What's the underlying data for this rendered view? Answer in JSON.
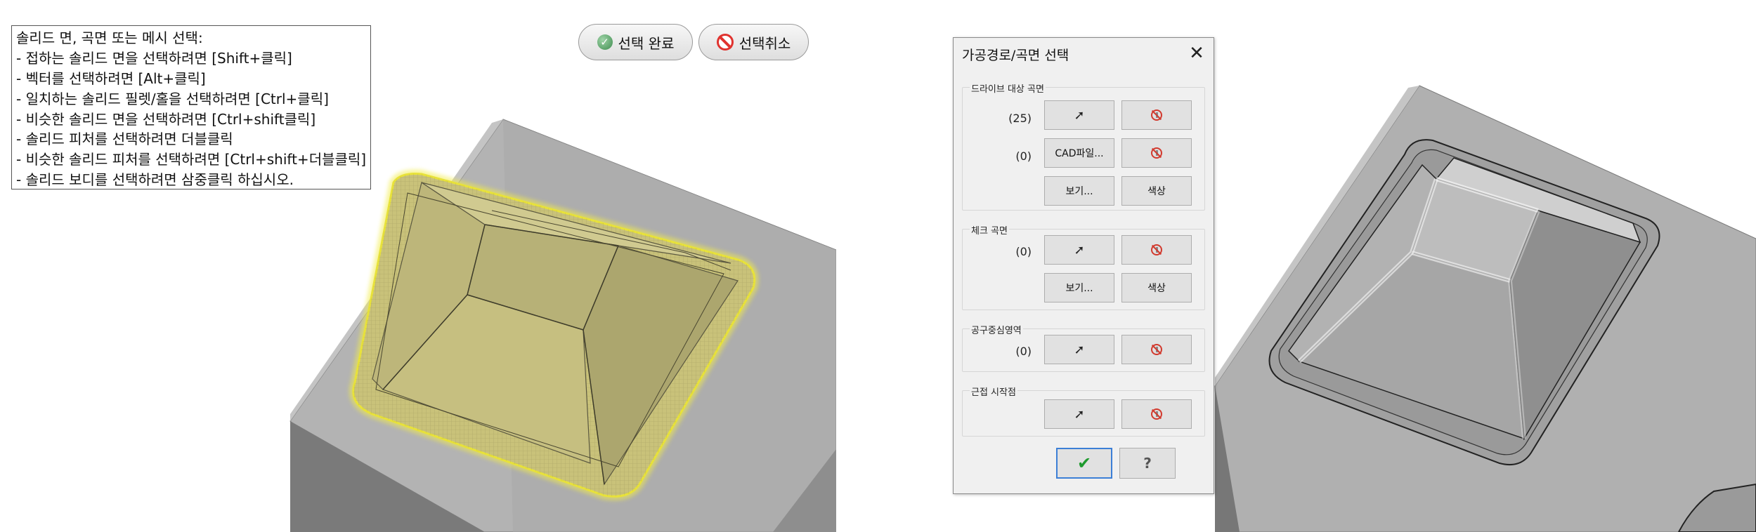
{
  "instructions": {
    "lines": [
      "솔리드 면, 곡면 또는 메시 선택:",
      "- 접하는 솔리드 면을 선택하려면 [Shift+클릭]",
      "- 벡터를 선택하려면 [Alt+클릭]",
      "- 일치하는 솔리드 필렛/홀을 선택하려면 [Ctrl+클릭]",
      "- 비슷한 솔리드 면을 선택하려면 [Ctrl+shift클릭]",
      "- 솔리드 피처를 선택하려면 더블클릭",
      "- 비슷한 솔리드 피처를 선택하려면 [Ctrl+shift+더블클릭]",
      "- 솔리드 보디를 선택하려면 삼중클릭 하십시오."
    ]
  },
  "top_buttons": {
    "done_label": "선택 완료",
    "done_icon": "check-circle-icon",
    "cancel_label": "선택취소",
    "cancel_icon": "no-entry-icon"
  },
  "dialog": {
    "title": "가공경로/곡면 선택",
    "close_icon": "close-icon",
    "groups": {
      "drive": {
        "label": "드라이브 대상 곡면",
        "count1": "(25)",
        "count2": "(0)",
        "cad_label": "CAD파일...",
        "view_label": "보기...",
        "color_label": "색상"
      },
      "check": {
        "label": "체크 곡면",
        "count": "(0)",
        "view_label": "보기...",
        "color_label": "색상"
      },
      "tool_center": {
        "label": "공구중심영역",
        "count": "(0)"
      },
      "approach": {
        "label": "근접 시작점"
      }
    },
    "ok_icon": "checkmark-icon",
    "help_icon": "help-icon"
  },
  "colors": {
    "selection_highlight": "#e8e23a",
    "selected_fill": "#c9c27a",
    "model_gray": "#a9a9a9",
    "dialog_bg": "#f0f0f0",
    "ok_border": "#3c7fd6"
  }
}
